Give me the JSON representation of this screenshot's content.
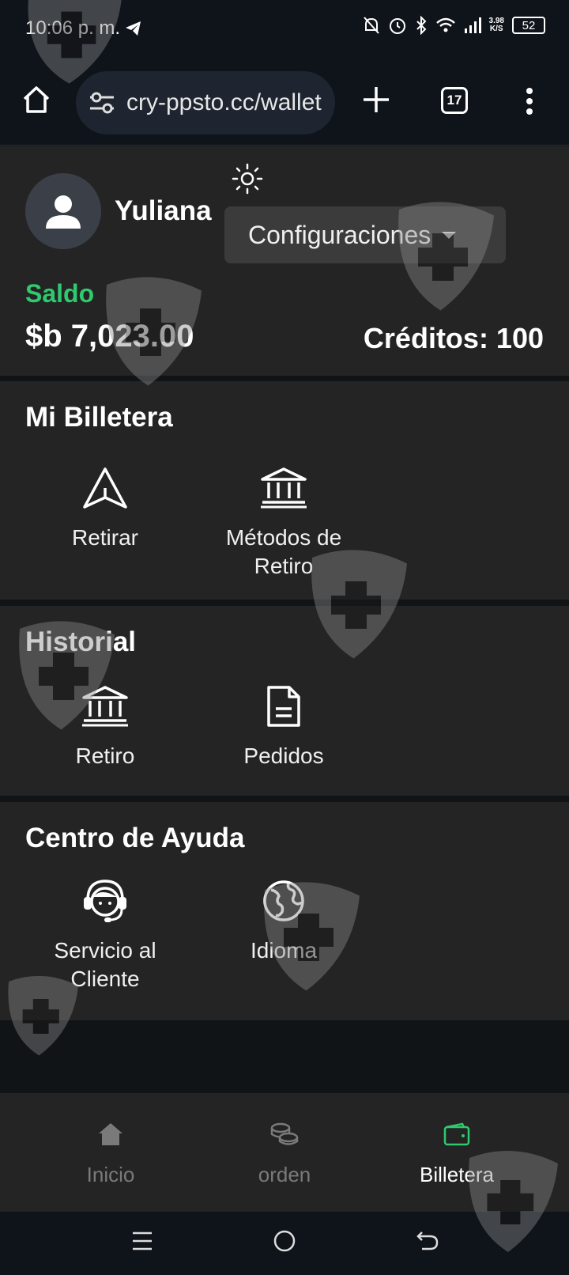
{
  "status_bar": {
    "time": "10:06 p. m.",
    "speed_value": "3.98",
    "speed_unit": "K/S",
    "battery": "52"
  },
  "browser": {
    "url": "cry-ppsto.cc/wallet",
    "tab_count": "17"
  },
  "profile": {
    "username": "Yuliana",
    "settings_label": "Configuraciones",
    "balance_label": "Saldo",
    "balance_value": "$b 7,023.00",
    "credits": "Créditos: 100"
  },
  "wallet": {
    "title": "Mi Billetera",
    "withdraw_label": "Retirar",
    "methods_label": "Métodos de Retiro"
  },
  "history": {
    "title": "Historial",
    "withdrawals_label": "Retiro",
    "orders_label": "Pedidos"
  },
  "help": {
    "title": "Centro de Ayuda",
    "support_label": "Servicio al Cliente",
    "language_label": "Idioma"
  },
  "bottom_nav": {
    "items": [
      {
        "label": "Inicio",
        "icon": "home-icon"
      },
      {
        "label": "orden",
        "icon": "coins-icon"
      },
      {
        "label": "Billetera",
        "icon": "wallet-icon",
        "active": true
      }
    ]
  },
  "colors": {
    "accent_green": "#2fc96e",
    "panel": "#242424",
    "background": "#111417"
  }
}
